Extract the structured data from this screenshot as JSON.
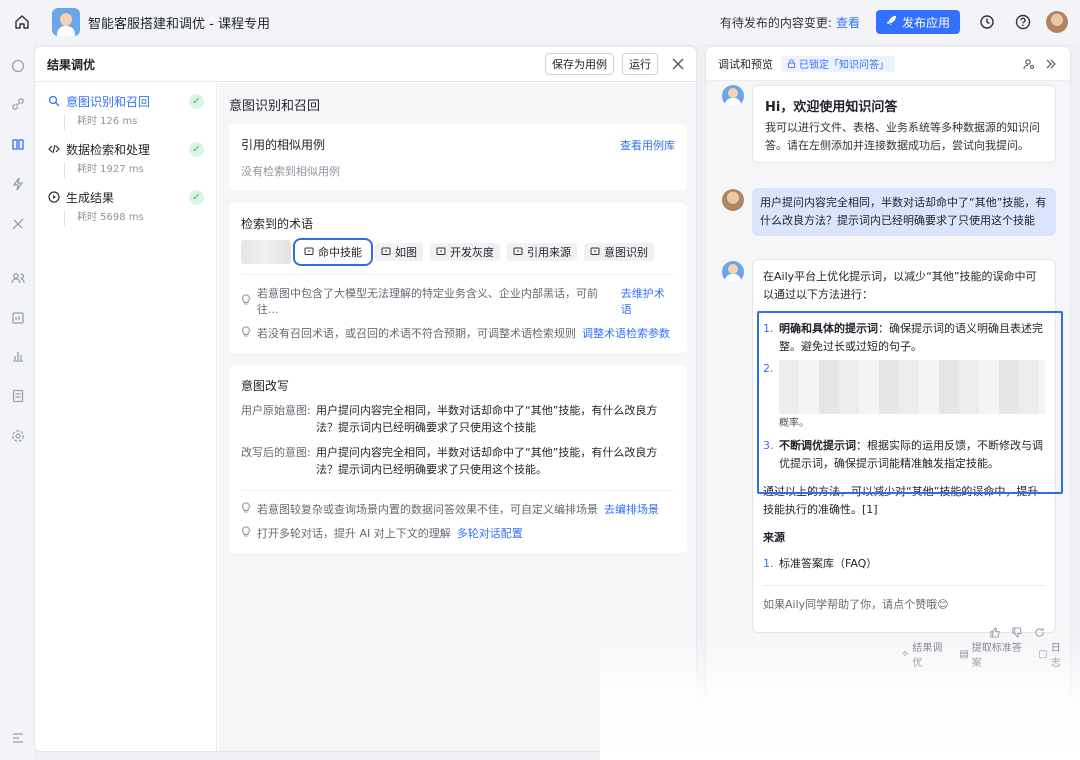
{
  "topbar": {
    "app_title": "智能客服搭建和调优 - 课程专用",
    "pending_text": "有待发布的内容变更:",
    "pending_link": "查看",
    "publish_label": "发布应用"
  },
  "result_panel": {
    "title": "结果调优",
    "save_case_label": "保存为用例",
    "run_label": "运行",
    "steps": [
      {
        "name": "意图识别和召回",
        "time": "耗时 126 ms"
      },
      {
        "name": "数据检索和处理",
        "time": "耗时 1927 ms"
      },
      {
        "name": "生成结果",
        "time": "耗时 5698 ms"
      }
    ],
    "detail_title": "意图识别和召回",
    "cases": {
      "title": "引用的相似用例",
      "link": "查看用例库",
      "empty": "没有检索到相似用例"
    },
    "terms": {
      "title": "检索到的术语",
      "tags": [
        "命中技能",
        "如图",
        "开发灰度",
        "引用来源",
        "意图识别"
      ],
      "tip1_text": "若意图中包含了大模型无法理解的特定业务含义、企业内部黑话，可前往...",
      "tip1_link": "去维护术语",
      "tip2_text": "若没有召回术语，或召回的术语不符合预期，可调整术语检索规则",
      "tip2_link": "调整术语检索参数"
    },
    "rewrite": {
      "title": "意图改写",
      "original_label": "用户原始意图:",
      "original_text": "用户提问内容完全相同，半数对话却命中了“其他”技能，有什么改良方法？提示词内已经明确要求了只使用这个技能",
      "rewritten_label": "改写后的意图:",
      "rewritten_text": "用户提问内容完全相同，半数对话却命中了“其他”技能，有什么改良方法？提示词内已经明确要求了只使用这个技能。",
      "tip1_text": "若意图较复杂或查询场景内置的数据问答效果不佳，可自定义编排场景",
      "tip1_link": "去编排场景",
      "tip2_text": "打开多轮对话，提升 AI 对上下文的理解",
      "tip2_link": "多轮对话配置"
    }
  },
  "preview": {
    "title": "调试和预览",
    "lock_label": "已锁定「知识问答」",
    "welcome_title": "Hi，欢迎使用知识问答",
    "welcome_body": "我可以进行文件、表格、业务系统等多种数据源的知识问答。请在左侧添加并连接数据成功后，尝试向我提问。",
    "user_question": "用户提问内容完全相同，半数对话却命中了“其他”技能，有什么改良方法？提示词内已经明确要求了只使用这个技能",
    "answer_intro": "在Aily平台上优化提示词，以减少“其他”技能的误命中可以通过以下方法进行：",
    "list": [
      {
        "num": "1.",
        "bold": "明确和具体的提示词",
        "text": "：确保提示词的语义明确且表述完整。避免过长或过短的句子。"
      },
      {
        "num": "2.",
        "bold": "",
        "text": "概率。"
      },
      {
        "num": "3.",
        "bold": "不断调优提示词",
        "text": "：根据实际的运用反馈，不断修改与调优提示词，确保提示词能精准触发指定技能。"
      }
    ],
    "answer_outro": "通过以上的方法，可以减少对“其他”技能的误命中，提升技能执行的准确性。[1]",
    "source_label": "来源",
    "source_item_num": "1.",
    "source_item": "标准答案库（FAQ）",
    "feedback_prompt": "如果Aily同学帮助了你，请点个赞哦😊",
    "footer_links": [
      "结果调优",
      "提取标准答案",
      "日志"
    ]
  }
}
